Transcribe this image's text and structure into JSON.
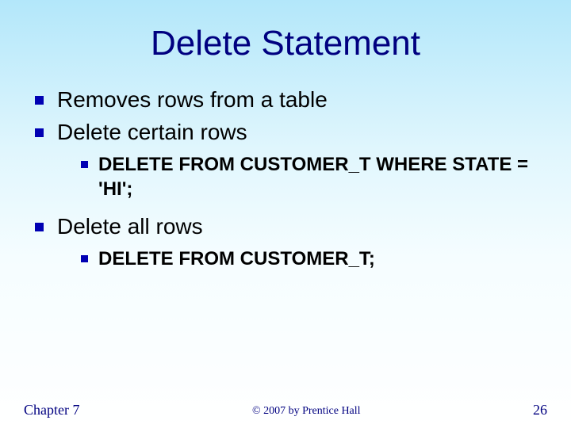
{
  "title": "Delete Statement",
  "bullets": {
    "0": {
      "text": "Removes rows from a table"
    },
    "1": {
      "text": "Delete certain rows",
      "sub": {
        "0": "DELETE FROM CUSTOMER_T WHERE STATE = 'HI';"
      }
    },
    "2": {
      "text": "Delete all rows",
      "sub": {
        "0": "DELETE FROM CUSTOMER_T;"
      }
    }
  },
  "footer": {
    "left": "Chapter 7",
    "center": "© 2007 by Prentice Hall",
    "right": "26"
  }
}
